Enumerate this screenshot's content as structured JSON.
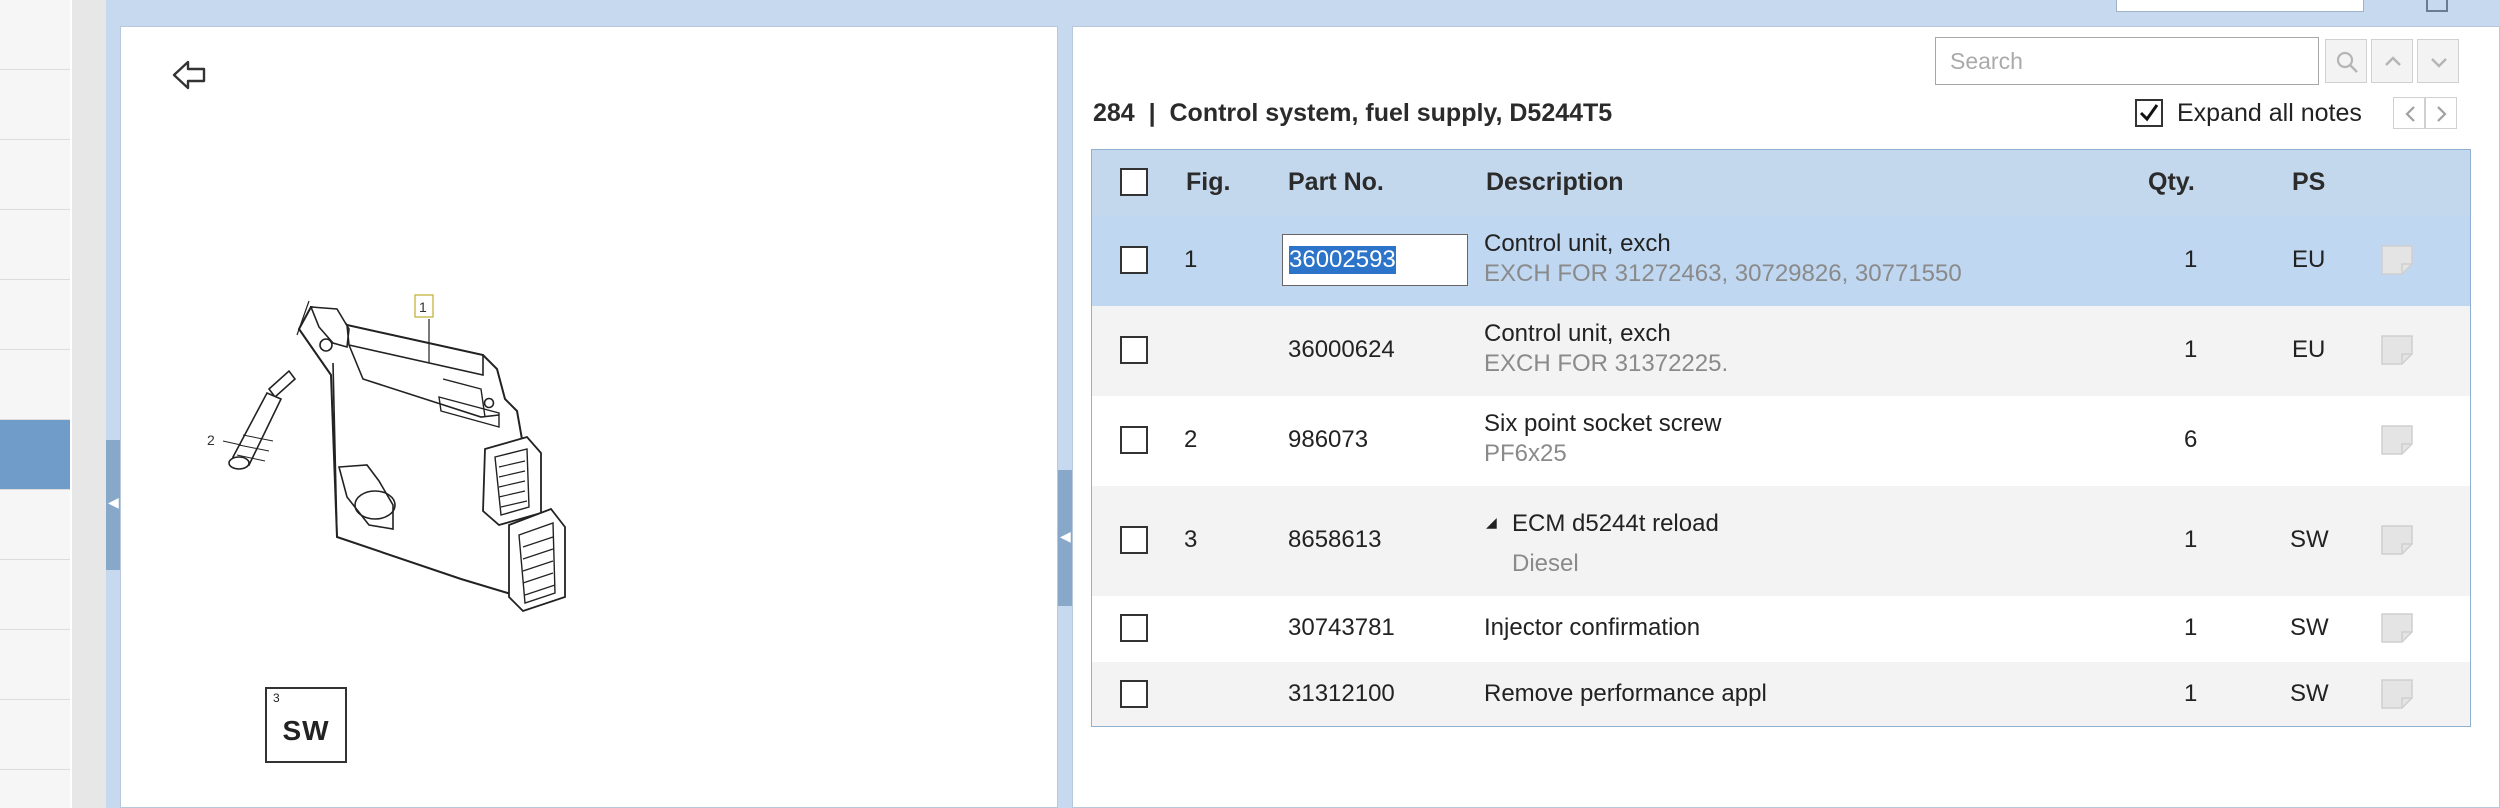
{
  "search": {
    "placeholder": "Search"
  },
  "heading": {
    "text": "284  |  Control system, fuel supply, D5244T5"
  },
  "expand": {
    "label": "Expand all notes",
    "checked": true
  },
  "table": {
    "columns": {
      "fig": "Fig.",
      "part_no": "Part No.",
      "description": "Description",
      "qty": "Qty.",
      "ps": "PS"
    },
    "rows": [
      {
        "fig": "1",
        "part_no": "36002593",
        "description": "Control unit, exch",
        "note": "EXCH FOR 31272463, 30729826, 30771550",
        "qty": "1",
        "ps": "EU",
        "selected": true
      },
      {
        "fig": "",
        "part_no": "36000624",
        "description": "Control unit, exch",
        "note": "EXCH FOR 31372225.",
        "qty": "1",
        "ps": "EU"
      },
      {
        "fig": "2",
        "part_no": "986073",
        "description": "Six point socket screw",
        "note": "PF6x25",
        "qty": "6",
        "ps": ""
      },
      {
        "fig": "3",
        "part_no": "8658613",
        "description": "ECM d5244t reload",
        "note": "Diesel",
        "qty": "1",
        "ps": "SW"
      },
      {
        "fig": "",
        "part_no": "30743781",
        "description": "Injector confirmation",
        "note": "",
        "qty": "1",
        "ps": "SW"
      },
      {
        "fig": "",
        "part_no": "31312100",
        "description": "Remove performance appl",
        "note": "",
        "qty": "1",
        "ps": "SW"
      }
    ]
  },
  "drawing": {
    "callout_1": "1",
    "callout_2": "2",
    "sw_index": "3",
    "sw_label": "SW"
  },
  "colors": {
    "frame": "#c6d9ef",
    "header": "#c4d8ed",
    "selected_row": "#bfd7f0",
    "nav_active": "#6f9cc8"
  }
}
